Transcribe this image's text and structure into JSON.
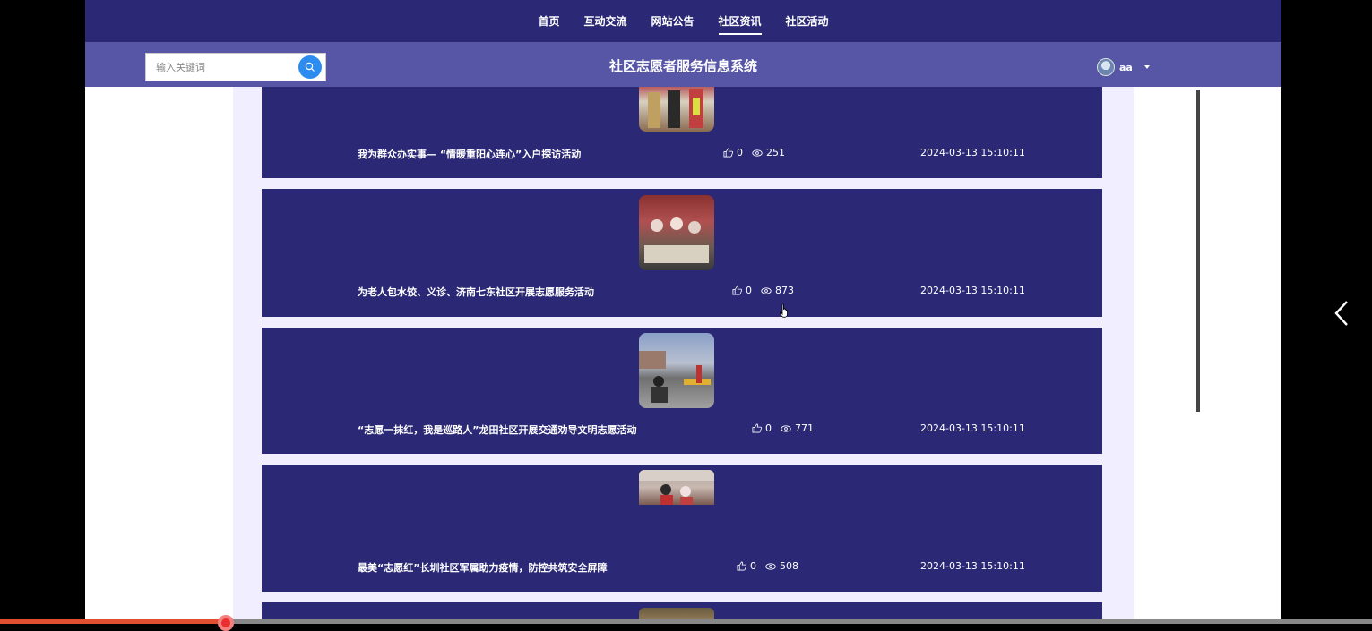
{
  "nav": {
    "items": [
      {
        "label": "首页",
        "active": false
      },
      {
        "label": "互动交流",
        "active": false
      },
      {
        "label": "网站公告",
        "active": false
      },
      {
        "label": "社区资讯",
        "active": true
      },
      {
        "label": "社区活动",
        "active": false
      }
    ]
  },
  "header": {
    "search_placeholder": "输入关键词",
    "site_title": "社区志愿者服务信息系统",
    "username": "aa"
  },
  "news": [
    {
      "title": "我为群众办实事— “情暖重阳心连心”入户探访活动",
      "likes": "0",
      "views": "251",
      "date": "2024-03-13 15:10:11"
    },
    {
      "title": "为老人包水饺、义诊、济南七东社区开展志愿服务活动",
      "likes": "0",
      "views": "873",
      "date": "2024-03-13 15:10:11"
    },
    {
      "title": "“志愿一抹红，我是巡路人”龙田社区开展交通劝导文明志愿活动",
      "likes": "0",
      "views": "771",
      "date": "2024-03-13 15:10:11"
    },
    {
      "title": "最美“志愿红”长圳社区军属助力疫情，防控共筑安全屏障",
      "likes": "0",
      "views": "508",
      "date": "2024-03-13 15:10:11"
    }
  ],
  "colors": {
    "nav_bg": "#2b2975",
    "subheader_bg": "#5655a6",
    "card_bg": "#2b2975",
    "content_bg": "#f1efff",
    "search_btn": "#2d8cf0"
  }
}
